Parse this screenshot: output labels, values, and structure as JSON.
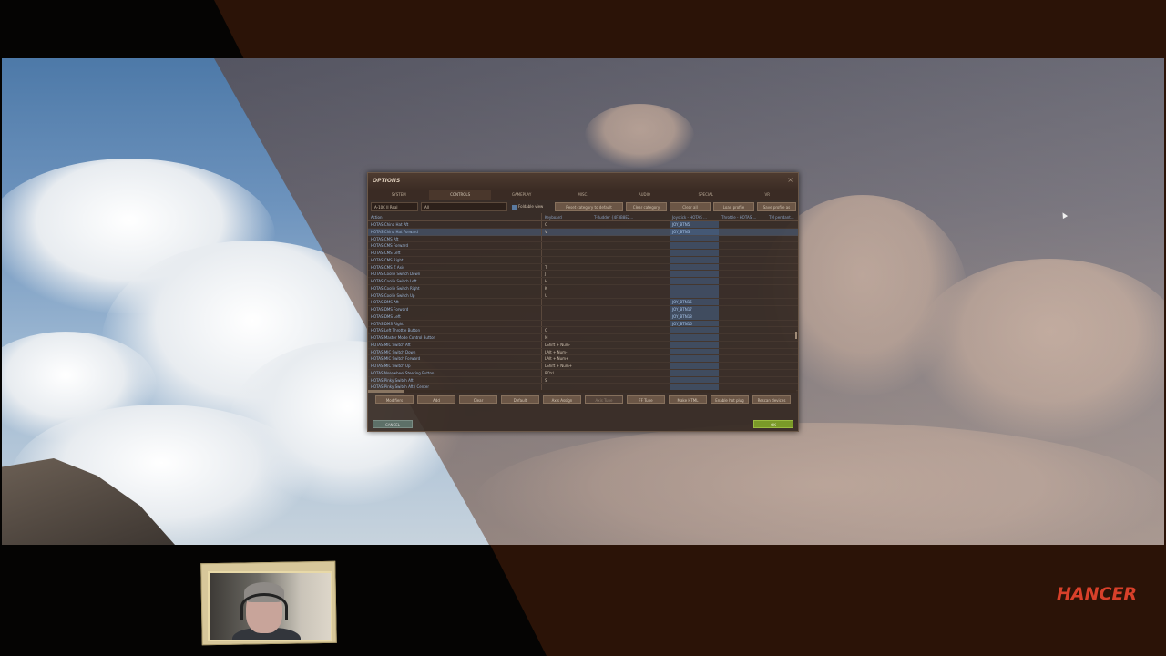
{
  "dialog": {
    "title": "OPTIONS",
    "close_glyph": "×"
  },
  "tabs": [
    {
      "label": "SYSTEM",
      "active": false
    },
    {
      "label": "CONTROLS",
      "active": true
    },
    {
      "label": "GAMEPLAY",
      "active": false
    },
    {
      "label": "MISC.",
      "active": false
    },
    {
      "label": "AUDIO",
      "active": false
    },
    {
      "label": "SPECIAL",
      "active": false
    },
    {
      "label": "VR",
      "active": false
    }
  ],
  "toolbar": {
    "aircraft_select": "A-10C II Real",
    "category_select": "All",
    "foldable_view": "Foldable view",
    "reset_category": "Reset category to default",
    "clear_category": "Clear category",
    "clear_all": "Clear all",
    "load_profile": "Load profile",
    "save_profile": "Save profile as"
  },
  "columns": {
    "action": "Action",
    "keyboard": "Keyboard",
    "rudder": "T-Rudder {4F3B8E2...",
    "joystick": "Joystick - HOTAS ...",
    "throttle": "Throttle - HOTAS ...",
    "throttle2": "TM pendant..."
  },
  "rows": [
    {
      "action": "HOTAS China Hat Aft",
      "keyboard": "C",
      "joystick": "JOY_BTN5",
      "selected": false
    },
    {
      "action": "HOTAS China Hat Forward",
      "keyboard": "V",
      "joystick": "JOY_BTN3",
      "selected": true
    },
    {
      "action": "HOTAS CMS Aft",
      "keyboard": "",
      "joystick": "",
      "selected": false
    },
    {
      "action": "HOTAS CMS Forward",
      "keyboard": "",
      "joystick": "",
      "selected": false
    },
    {
      "action": "HOTAS CMS Left",
      "keyboard": "",
      "joystick": "",
      "selected": false
    },
    {
      "action": "HOTAS CMS Right",
      "keyboard": "",
      "joystick": "",
      "selected": false
    },
    {
      "action": "HOTAS CMS Z Axis",
      "keyboard": "T",
      "joystick": "",
      "selected": false
    },
    {
      "action": "HOTAS Coolie Switch Down",
      "keyboard": "J",
      "joystick": "",
      "selected": false
    },
    {
      "action": "HOTAS Coolie Switch Left",
      "keyboard": "H",
      "joystick": "",
      "selected": false
    },
    {
      "action": "HOTAS Coolie Switch Right",
      "keyboard": "K",
      "joystick": "",
      "selected": false
    },
    {
      "action": "HOTAS Coolie Switch Up",
      "keyboard": "U",
      "joystick": "",
      "selected": false
    },
    {
      "action": "HOTAS DMS Aft",
      "keyboard": "",
      "joystick": "JOY_BTN15",
      "selected": false
    },
    {
      "action": "HOTAS DMS Forward",
      "keyboard": "",
      "joystick": "JOY_BTN17",
      "selected": false
    },
    {
      "action": "HOTAS DMS Left",
      "keyboard": "",
      "joystick": "JOY_BTN18",
      "selected": false
    },
    {
      "action": "HOTAS DMS Right",
      "keyboard": "",
      "joystick": "JOY_BTN16",
      "selected": false
    },
    {
      "action": "HOTAS Left Throttle Button",
      "keyboard": "Q",
      "joystick": "",
      "selected": false
    },
    {
      "action": "HOTAS Master Mode Control Button",
      "keyboard": "M",
      "joystick": "",
      "selected": false
    },
    {
      "action": "HOTAS MIC Switch Aft",
      "keyboard": "LShift + Num-",
      "joystick": "",
      "selected": false
    },
    {
      "action": "HOTAS MIC Switch Down",
      "keyboard": "LAlt + Num-",
      "joystick": "",
      "selected": false
    },
    {
      "action": "HOTAS MIC Switch Forward",
      "keyboard": "LAlt + Num+",
      "joystick": "",
      "selected": false
    },
    {
      "action": "HOTAS MIC Switch Up",
      "keyboard": "LShift + Num+",
      "joystick": "",
      "selected": false
    },
    {
      "action": "HOTAS Nosewheel Steering Button",
      "keyboard": "RCtrl",
      "joystick": "",
      "selected": false
    },
    {
      "action": "HOTAS Pinky Switch Aft",
      "keyboard": "S",
      "joystick": "",
      "selected": false
    },
    {
      "action": "HOTAS Pinky Switch Aft / Center",
      "keyboard": "",
      "joystick": "",
      "selected": false
    }
  ],
  "bottom_buttons": [
    {
      "label": "Modifiers",
      "dim": false
    },
    {
      "label": "Add",
      "dim": false
    },
    {
      "label": "Clear",
      "dim": false
    },
    {
      "label": "Default",
      "dim": false
    },
    {
      "label": "Axis Assign",
      "dim": false
    },
    {
      "label": "Axis Tune",
      "dim": true
    },
    {
      "label": "FF Tune",
      "dim": false
    },
    {
      "label": "Make HTML",
      "dim": false
    },
    {
      "label": "Enable hot plug",
      "dim": false
    },
    {
      "label": "Rescan devices",
      "dim": false
    }
  ],
  "footer": {
    "cancel": "CANCEL",
    "ok": "OK"
  },
  "brand": {
    "text": "HANCER",
    "color": "#d8402a"
  },
  "colors": {
    "ok_green": "#7a9a28",
    "selected_row": "#506e96",
    "record_dot": "#e01010"
  }
}
